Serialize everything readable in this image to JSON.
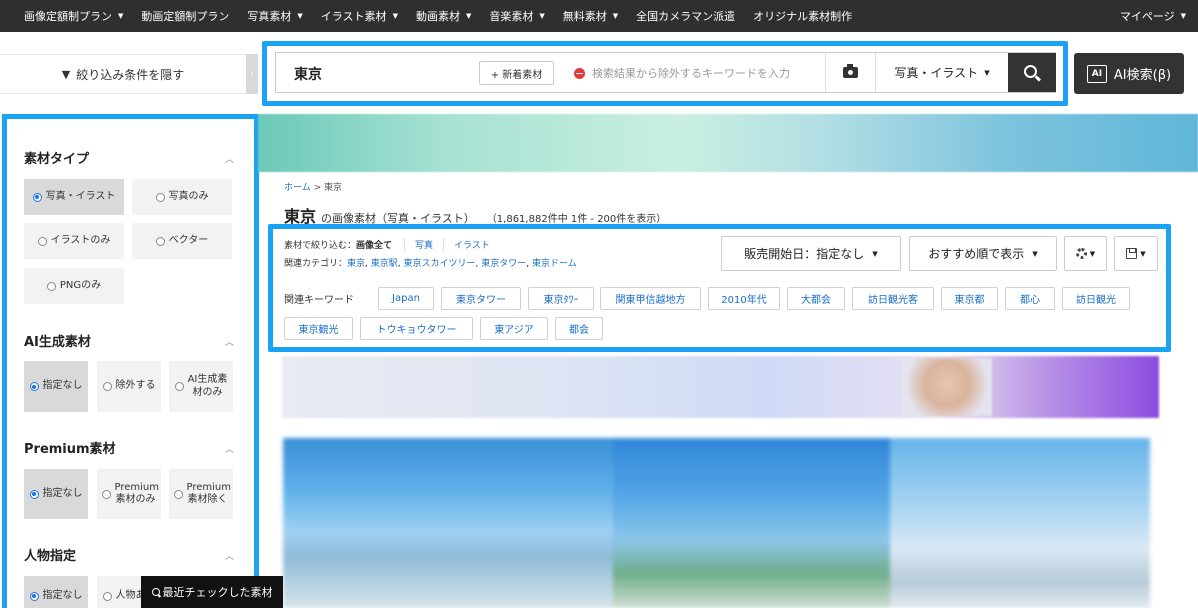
{
  "topnav": {
    "items": [
      {
        "label": "画像定額制プラン",
        "caret": true
      },
      {
        "label": "動画定額制プラン",
        "caret": false
      },
      {
        "label": "写真素材",
        "caret": true
      },
      {
        "label": "イラスト素材",
        "caret": true
      },
      {
        "label": "動画素材",
        "caret": true
      },
      {
        "label": "音楽素材",
        "caret": true
      },
      {
        "label": "無料素材",
        "caret": true
      },
      {
        "label": "全国カメラマン派遣",
        "caret": false
      },
      {
        "label": "オリジナル素材制作",
        "caret": false
      }
    ],
    "mypage": "マイページ"
  },
  "filter_toggle": {
    "label": "絞り込み条件を隠す",
    "collapse_glyph": "‹"
  },
  "search": {
    "query": "東京",
    "new_button": "+ 新着素材",
    "exclude_placeholder": "検索結果から除外するキーワードを入力",
    "type_select": "写真・イラスト"
  },
  "ai_search": {
    "chip": "AI",
    "label": "AI検索(β)"
  },
  "sidebar": {
    "sections": [
      {
        "title": "素材タイプ",
        "options": [
          "写真・イラスト",
          "写真のみ",
          "イラストのみ",
          "ベクター",
          "PNGのみ"
        ],
        "selected": 0
      },
      {
        "title": "AI生成素材",
        "options": [
          "指定なし",
          "除外する",
          "AI生成素材のみ"
        ],
        "selected": 0
      },
      {
        "title": "Premium素材",
        "options": [
          "指定なし",
          "Premium素材のみ",
          "Premium素材除く"
        ],
        "selected": 0
      },
      {
        "title": "人物指定",
        "options": [
          "指定なし",
          "人物あり"
        ],
        "selected": 0
      }
    ]
  },
  "breadcrumb": {
    "home": "ホーム",
    "sep": ">",
    "current": "東京"
  },
  "title": {
    "keyword": "東京",
    "suffix": "の画像素材（写真・イラスト）",
    "count": "（1,861,882件中 1件 - 200件を表示）"
  },
  "narrow": {
    "label": "素材で絞り込む：",
    "current": "画像全て",
    "links": [
      "写真",
      "イラスト"
    ]
  },
  "related_category": {
    "label": "関連カテゴリ：",
    "links": [
      "東京",
      "東京駅",
      "東京スカイツリー",
      "東京タワー",
      "東京ドーム"
    ]
  },
  "controls": {
    "release_date": "販売開始日：指定なし",
    "sort": "おすすめ順で表示"
  },
  "keywords": {
    "label": "関連キーワード",
    "tags": [
      "Japan",
      "東京タワー",
      "東京ﾀﾜｰ",
      "関東甲信越地方",
      "2010年代",
      "大都会",
      "訪日観光客",
      "東京都",
      "都心",
      "訪日観光",
      "東京観光",
      "トウキョウタワー",
      "東アジア",
      "都会"
    ]
  },
  "recent": {
    "label": "最近チェックした素材"
  },
  "colors": {
    "highlight": "#1aa3f5",
    "nav_bg": "#2f2f2f",
    "link": "#1a6ec8"
  }
}
